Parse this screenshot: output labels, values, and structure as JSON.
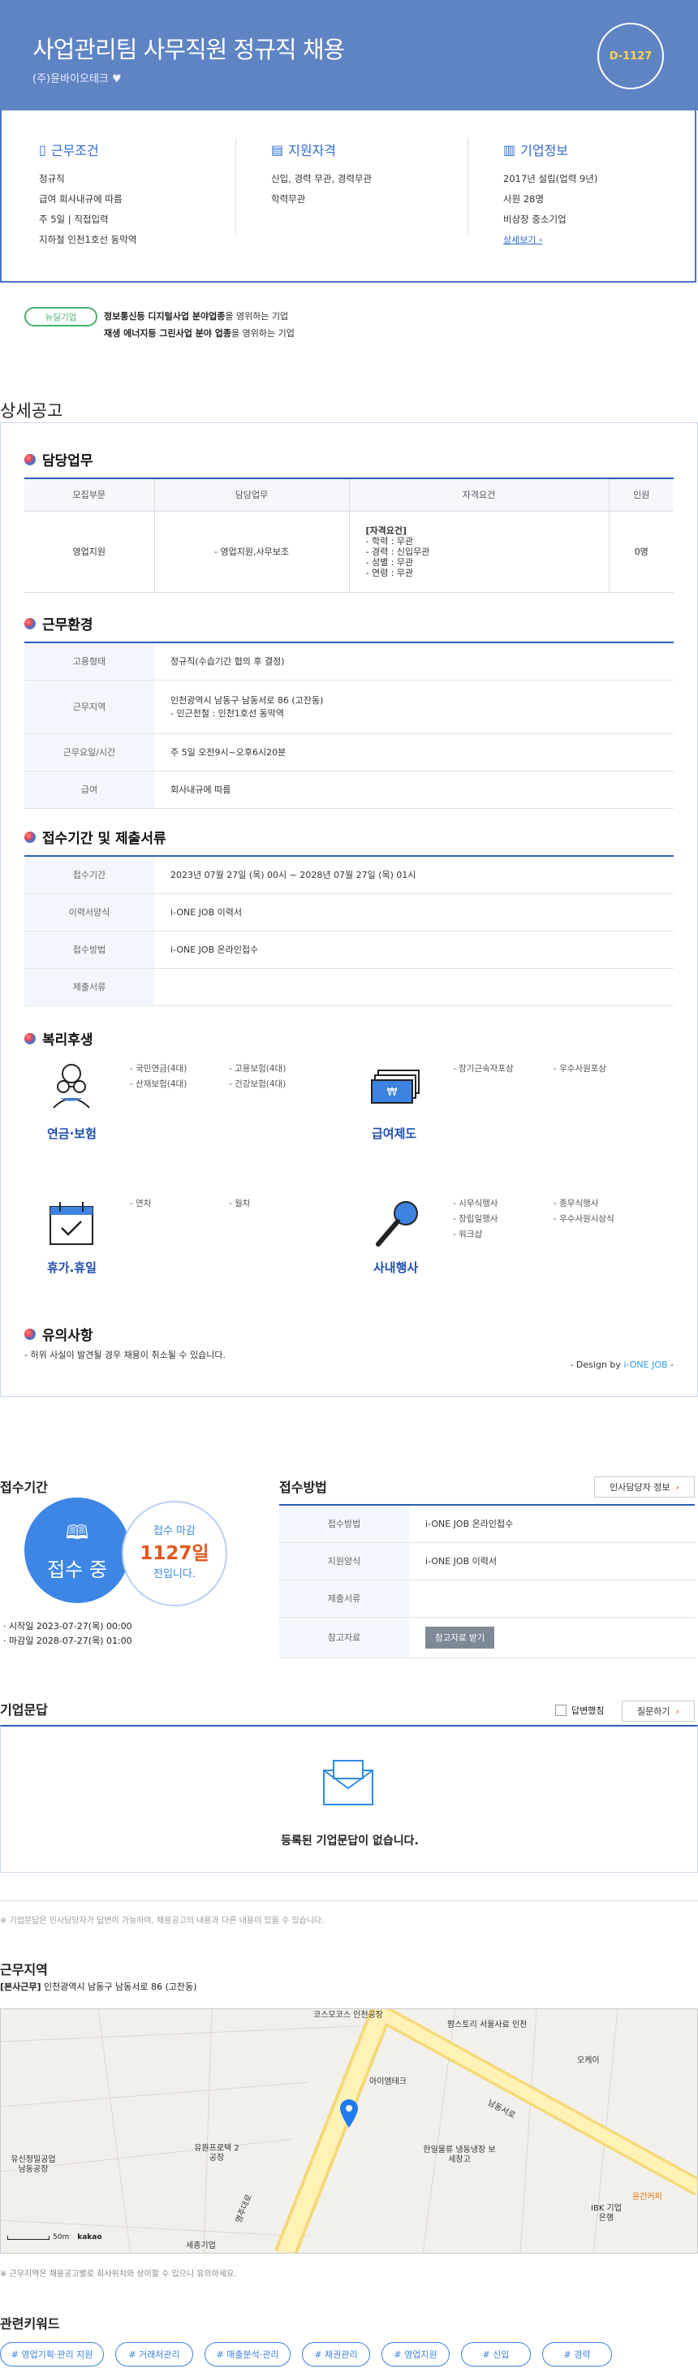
{
  "header": {
    "title": "사업관리팀 사무직원 정규직 채용",
    "company": "(주)윤바이오테크",
    "dday": "D-1127"
  },
  "conditions": {
    "title": "근무조건",
    "lines": [
      "정규직",
      "급여 회사내규에 따름",
      "주 5일 | 직접입력",
      "지하철 인천1호선 동막역"
    ]
  },
  "qualification": {
    "title": "지원자격",
    "lines": [
      "신입, 경력 무관, 경력무관",
      "학력무관"
    ]
  },
  "companyinfo": {
    "title": "기업정보",
    "lines": [
      "2017년 설립(업력 9년)",
      "사원 28명",
      "비상장 중소기업"
    ],
    "more": "상세보기"
  },
  "green": {
    "badge": "뉴딜기업",
    "line1_bold": "정보통신등 디지털사업 분야업종",
    "line1_rest": "을 영위하는 기업",
    "line2_bold": "재생 에너지등 그린사업 분야 업종",
    "line2_rest": "을 영위하는 기업"
  },
  "detail": {
    "title": "상세공고",
    "duty": {
      "title": "담당업무",
      "headers": [
        "모집부문",
        "담당업무",
        "자격요건",
        "인원"
      ],
      "row": {
        "dept": "영업지원",
        "task": "- 영업지원,사무보조",
        "req_title": "[자격요건]",
        "req_lines": [
          "- 학력 : 무관",
          "- 경력 : 신입무관",
          "- 성별 : 무관",
          "- 연령 : 무관"
        ],
        "count": "0명"
      }
    },
    "env": {
      "title": "근무환경",
      "rows": [
        [
          "고용형태",
          "정규직(수습기간 협의 후 결정)"
        ],
        [
          "근무지역",
          "인천광역시 남동구 남동서로 86 (고잔동)"
        ],
        [
          "근무요일/시간",
          "주 5일 오전9시~오후6시20분"
        ],
        [
          "급여",
          "회사내규에 따름"
        ]
      ],
      "region_extra": "- 인근전철 : 인천1호선 동막역"
    },
    "apply": {
      "title": "접수기간 및 제출서류",
      "rows": [
        [
          "접수기간",
          "2023년 07월 27일 (목) 00시 ~ 2028년 07월 27일 (목) 01시"
        ],
        [
          "이력서양식",
          "i-ONE JOB 이력서"
        ],
        [
          "접수방법",
          "i-ONE JOB 온라인접수"
        ],
        [
          "제출서류",
          ""
        ]
      ]
    },
    "welfare": {
      "title": "복리후생",
      "groups": [
        {
          "name": "연금·보험",
          "items": [
            "- 국민연금(4대)",
            "- 고용보험(4대)",
            "- 산재보험(4대)",
            "- 건강보험(4대)"
          ]
        },
        {
          "name": "급여제도",
          "items": [
            "- 장기근속자포상",
            "- 우수사원포상"
          ]
        },
        {
          "name": "휴가.휴일",
          "items": [
            "- 연차",
            "- 월차"
          ]
        },
        {
          "name": "사내행사",
          "items": [
            "- 시무식행사",
            "- 종무식행사",
            "- 창립일행사",
            "- 우수사원시상식",
            "- 워크샵"
          ]
        }
      ]
    },
    "caution": {
      "title": "유의사항",
      "text": "- 허위 사실이 발견될 경우 채용이 취소될 수 있습니다.",
      "design_prefix": "- Design by ",
      "design_brand": "i-ONE JOB",
      "design_suffix": " -"
    }
  },
  "period": {
    "title": "접수기간",
    "status": "접수 중",
    "deadline_label": "접수 마감",
    "deadline_days": "1127일",
    "deadline_suffix": "전입니다.",
    "start": "· 시작일 2023-07-27(목) 00:00",
    "end": "· 마감일 2028-07-27(목) 01:00"
  },
  "method": {
    "title": "접수방법",
    "contact_btn": "인사담당자 정보",
    "rows": [
      [
        "접수방법",
        "i-ONE JOB 온라인접수"
      ],
      [
        "지원양식",
        "i-ONE JOB 이력서"
      ],
      [
        "제출서류",
        ""
      ],
      [
        "참고자료",
        ""
      ]
    ],
    "ref_btn": "참고자료 받기"
  },
  "qna": {
    "title": "기업문답",
    "checkbox_label": "답변했침",
    "ask_btn": "질문하기",
    "empty": "등록된 기업문답이 없습니다.",
    "note": "※ 기업문답은 인사담당자가 답변이 가능하며, 채용공고의 내용과 다른 내용이 있을 수 있습니다."
  },
  "location": {
    "title": "근무지역",
    "label": "[본사근무]",
    "address": "인천광역시 남동구 남동서로 86 (고잔동)",
    "note": "※ 근무지역은 채용공고별로 회사위치와 상이할 수 있으니 유의하세요.",
    "map": {
      "scale": "50m",
      "brand": "kakao",
      "places": [
        "코스모코스 인천공장",
        "팜스토리 서울사료 인천",
        "오케이",
        "아이엠테크",
        "유신정밀공업 남동공장",
        "유원프로텍 2공장",
        "한일물류 냉동냉장 보세창고",
        "IBK 기업은행",
        "윤간커피",
        "세종기업",
        "남동서로",
        "명주대로"
      ]
    }
  },
  "keywords": {
    "title": "관련키워드",
    "items": [
      "# 영업기획·관리 지원",
      "# 거래처관리",
      "# 매출분석·관리",
      "# 채권관리",
      "# 영업지원",
      "# 신입",
      "# 경력"
    ]
  }
}
